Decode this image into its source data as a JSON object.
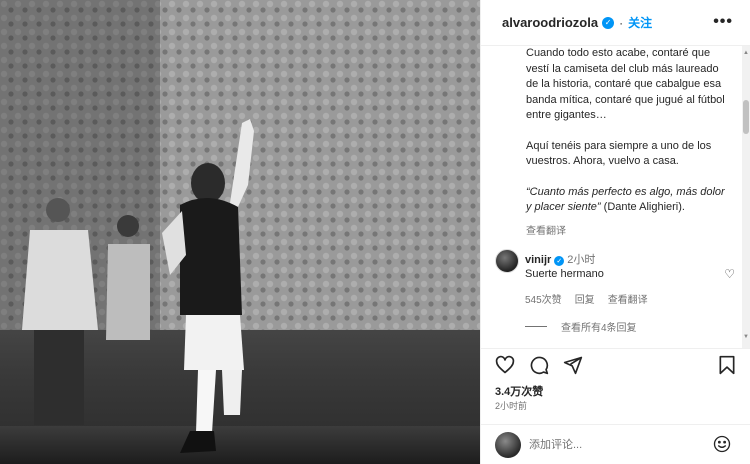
{
  "post": {
    "username": "alvaroodriozola",
    "verified_mark": "✓",
    "follow_label": "关注",
    "caption_paragraphs": [
      "Cuando todo esto acabe, contaré que vestí la camiseta del club más laureado de la historia, contaré que cabalgue esa banda mítica, contaré que jugué al fútbol entre gigantes…",
      "Aquí tenéis para siempre a uno de los vuestros. Ahora, vuelvo a casa."
    ],
    "quote_italic": "“Cuanto más perfecto es algo, más dolor y placer siente”",
    "quote_author": "(Dante Alighieri).",
    "translate_label": "查看翻译",
    "likes": "3.4万次赞",
    "time_ago": "2小时前"
  },
  "comment": {
    "username": "vinijr",
    "time": "2小时",
    "text": "Suerte hermano",
    "likes": "545次赞",
    "reply_label": "回复",
    "translate_label": "查看翻译",
    "view_replies": "查看所有4条回复"
  },
  "comment_input": {
    "placeholder": "添加评论..."
  },
  "icons": {
    "more": "more-icon",
    "like": "heart-icon",
    "comment": "comment-icon",
    "share": "send-icon",
    "save": "bookmark-icon",
    "emoji": "emoji-icon"
  },
  "colors": {
    "accent": "#0095f6",
    "text": "#262626",
    "secondary": "#737373"
  }
}
